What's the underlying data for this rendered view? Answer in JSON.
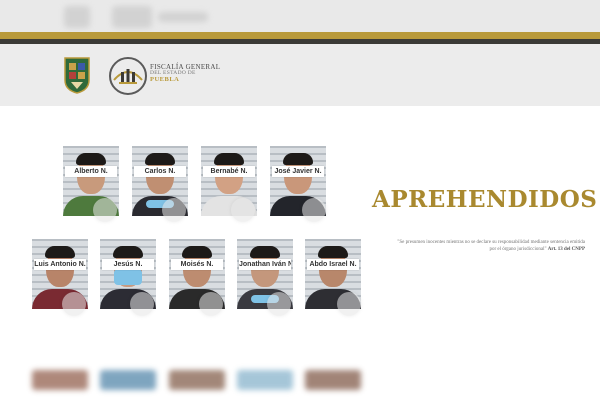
{
  "institution": {
    "line1": "FISCALÍA GENERAL",
    "line2": "DEL ESTADO DE",
    "line3": "PUEBLA"
  },
  "title": "APREHENDIDOS",
  "legal_note": {
    "text": "\"Se presumen inocentes mientras no se declare su responsabilidad mediante sentencia emitida por el órgano jurisdiccional\"",
    "ref": "Art. 13 del CNPP"
  },
  "detainees_row1": [
    {
      "name": "Alberto N."
    },
    {
      "name": "Carlos N."
    },
    {
      "name": "Bernabé N."
    },
    {
      "name": "José Javier N."
    }
  ],
  "detainees_row2": [
    {
      "name": "Luis Antonio N."
    },
    {
      "name": "Jesús N."
    },
    {
      "name": "Moisés N."
    },
    {
      "name": "Jonathan Iván N."
    },
    {
      "name": "Abdo Israel N."
    }
  ],
  "colors": {
    "gold": "#b99a3b",
    "title_gold": "#a9892f",
    "dark_bar": "#3b3a36"
  }
}
